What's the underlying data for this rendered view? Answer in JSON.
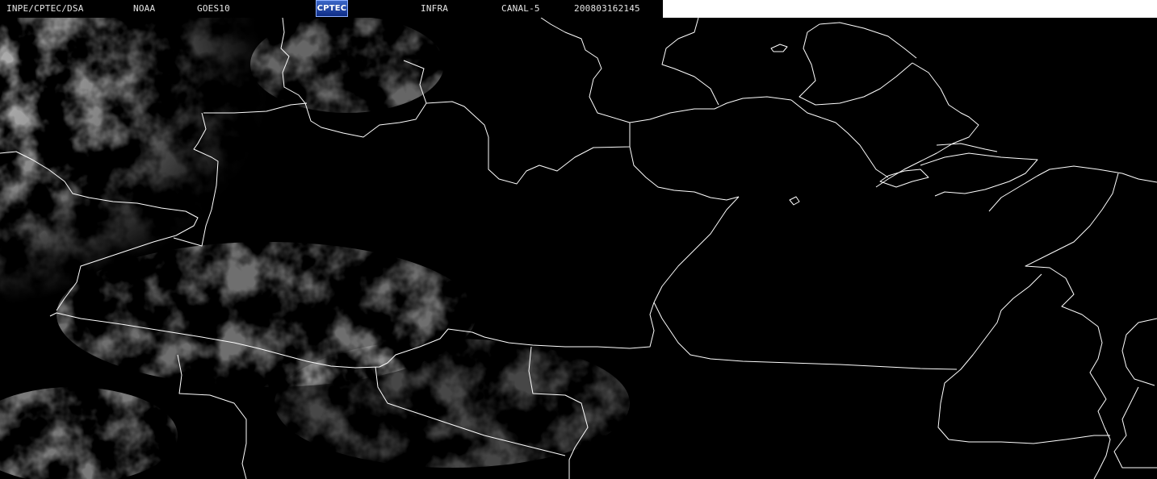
{
  "header": {
    "institution": "INPE/CPTEC/DSA",
    "agency": "NOAA",
    "satellite": "GOES10",
    "logo_text": "CPTEC",
    "band": "INFRA",
    "channel": "CANAL-5",
    "datetime": "200803162145"
  },
  "map": {
    "background_color": "#000000",
    "border_color": "#ffffff",
    "cloud_color": "#9a9a9a"
  }
}
